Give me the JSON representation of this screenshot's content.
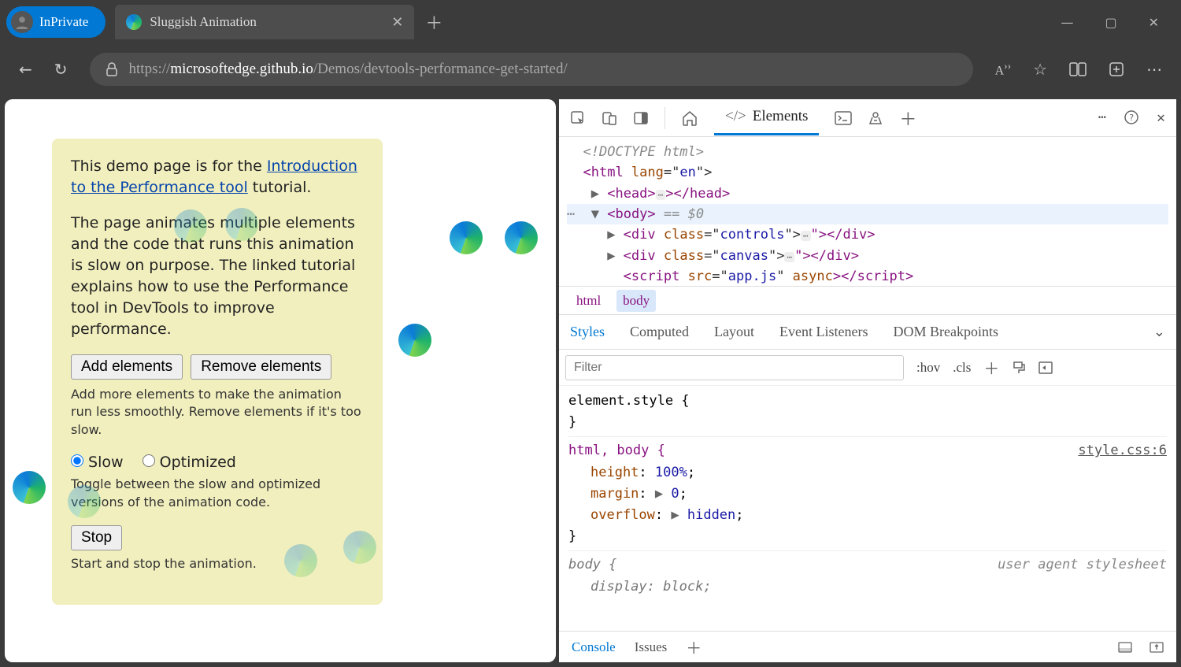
{
  "titlebar": {
    "badge_label": "InPrivate",
    "tab_title": "Sluggish Animation"
  },
  "address": {
    "protocol": "https://",
    "domain": "microsoftedge.github.io",
    "path": "/Demos/devtools-performance-get-started/"
  },
  "page": {
    "intro_1": "This demo page is for the ",
    "intro_link": "Introduction to the Performance tool",
    "intro_2": " tutorial.",
    "desc": "The page animates multiple elements and the code that runs this animation is slow on purpose. The linked tutorial explains how to use the Performance tool in DevTools to improve performance.",
    "add_btn": "Add elements",
    "remove_btn": "Remove elements",
    "add_hint": "Add more elements to make the animation run less smoothly. Remove elements if it's too slow.",
    "radio_slow": "Slow",
    "radio_opt": "Optimized",
    "radio_hint": "Toggle between the slow and optimized versions of the animation code.",
    "stop_btn": "Stop",
    "stop_hint": "Start and stop the animation."
  },
  "devtools": {
    "tab_elements": "Elements",
    "dom": {
      "l1": "<!DOCTYPE html>",
      "l2a": "<",
      "l2b": "html ",
      "l2c": "lang",
      "l2d": "=\"",
      "l2e": "en",
      "l2f": "\">",
      "l3a": "<",
      "l3b": "head",
      "l3c": "></",
      "l3d": "head",
      "l3e": ">",
      "l4a": "<",
      "l4b": "body",
      "l4c": ">",
      "l4d": " == $0",
      "l5a": "<",
      "l5b": "div ",
      "l5c": "class",
      "l5d": "=\"",
      "l5e": "controls",
      "l5f": "\"></",
      "l5g": "div",
      "l5h": ">",
      "l6a": "<",
      "l6b": "div ",
      "l6c": "class",
      "l6d": "=\"",
      "l6e": "canvas",
      "l6f": "\"></",
      "l6g": "div",
      "l6h": ">",
      "l7a": "<",
      "l7b": "script ",
      "l7c": "src",
      "l7d": "=\"",
      "l7e": "app.js",
      "l7f": "\" ",
      "l7g": "async",
      "l7h": "></",
      "l7i": "script",
      "l7j": ">"
    },
    "crumb_html": "html",
    "crumb_body": "body",
    "subtabs": {
      "styles": "Styles",
      "computed": "Computed",
      "layout": "Layout",
      "listeners": "Event Listeners",
      "dom_bp": "DOM Breakpoints"
    },
    "filter_ph": "Filter",
    "hov": ":hov",
    "cls": ".cls",
    "styles_pane": {
      "inline": "element.style {",
      "rule_sel": "html, body {",
      "src": "style.css:6",
      "p1k": "height",
      "p1v": "100%",
      "p2k": "margin",
      "p2v": "0",
      "p3k": "overflow",
      "p3v": "hidden",
      "ua_sel": "body {",
      "ua_label": "user agent stylesheet",
      "ua_p1k": "display",
      "ua_p1v": "block"
    },
    "drawer": {
      "console": "Console",
      "issues": "Issues"
    }
  }
}
